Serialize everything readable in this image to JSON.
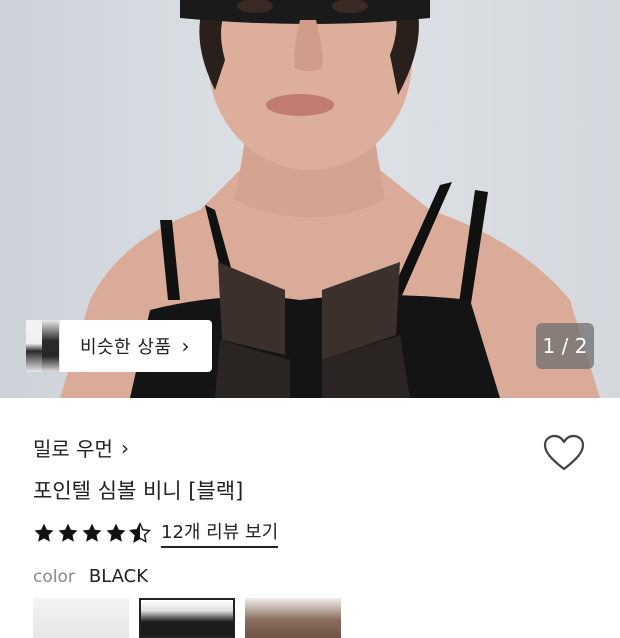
{
  "hero": {
    "similar_label": "비슷한 상품",
    "counter": "1 / 2"
  },
  "product": {
    "brand": "밀로 우먼",
    "title": "포인텔 심볼 비니 [블랙]",
    "rating": 4.5,
    "review_link": "12개 리뷰 보기",
    "color_label": "color",
    "color_value": "BLACK"
  },
  "icons": {
    "brand_chevron": "chevron-right-icon",
    "wishlist": "heart-outline-icon",
    "similar_chevron": "chevron-right-icon"
  },
  "colors": {
    "text": "#222222",
    "muted": "#888888",
    "counter_bg": "#6e6e6e"
  }
}
